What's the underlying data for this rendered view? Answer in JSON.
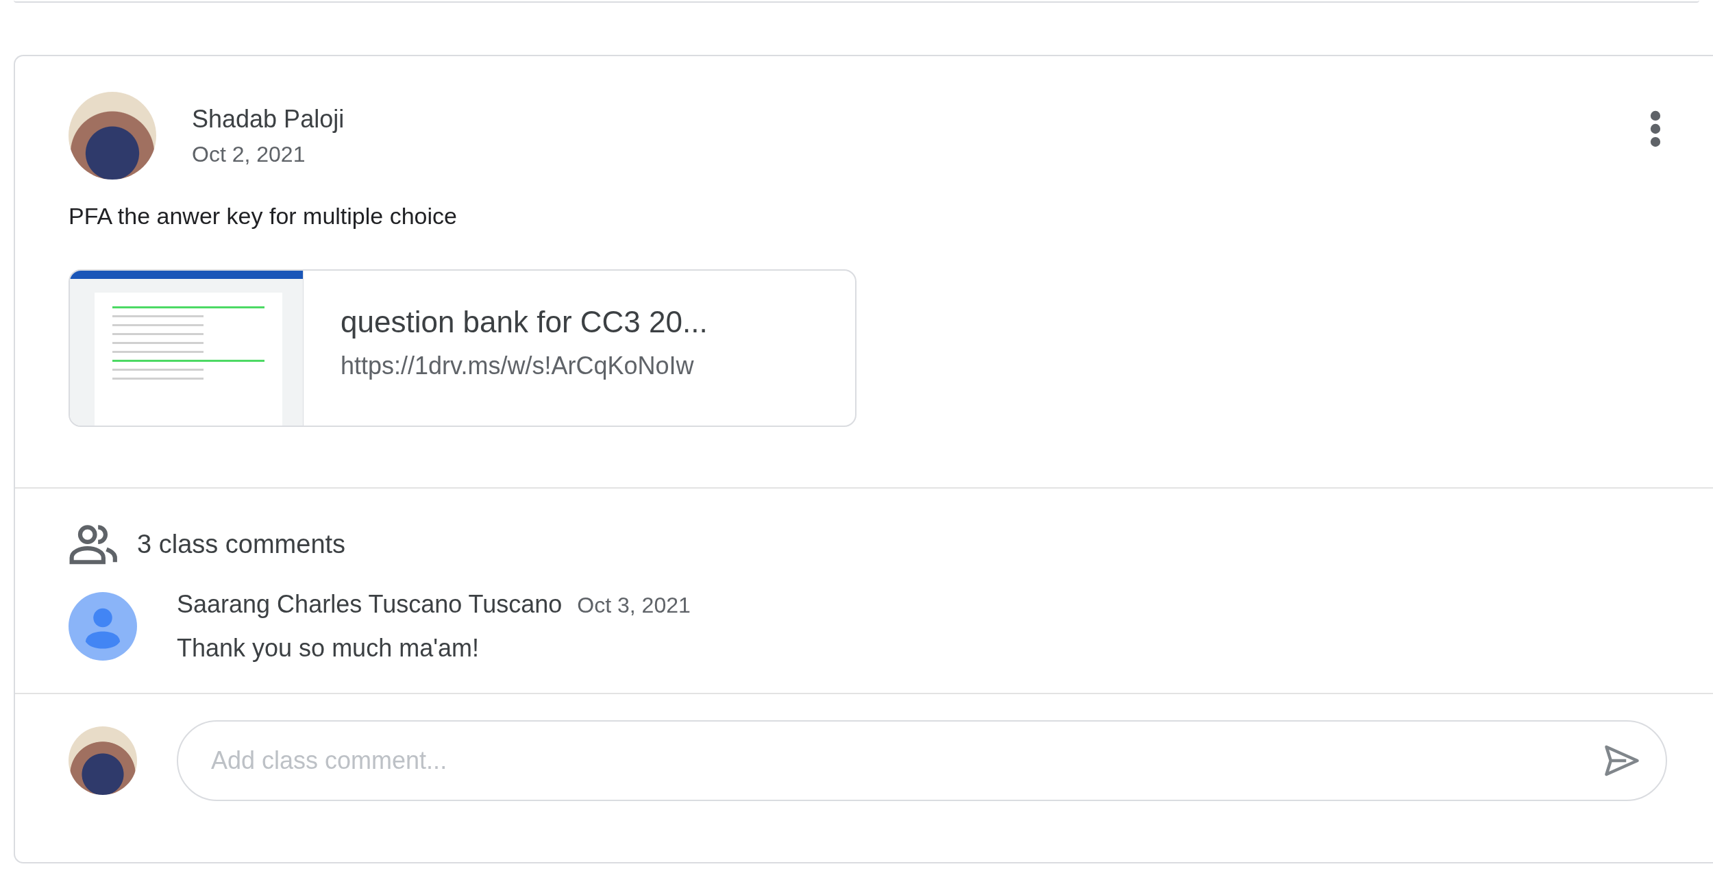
{
  "post": {
    "author": "Shadab Paloji",
    "date": "Oct 2, 2021",
    "text": "PFA the anwer key for multiple choice",
    "attachment": {
      "title": "question bank for CC3 20...",
      "url": "https://1drv.ms/w/s!ArCqKoNoIw"
    }
  },
  "comments_header": {
    "label": "3 class comments"
  },
  "comments": [
    {
      "author": "Saarang Charles Tuscano Tuscano",
      "date": "Oct 3, 2021",
      "text": "Thank you so much ma'am!"
    }
  ],
  "comment_input": {
    "placeholder": "Add class comment..."
  }
}
